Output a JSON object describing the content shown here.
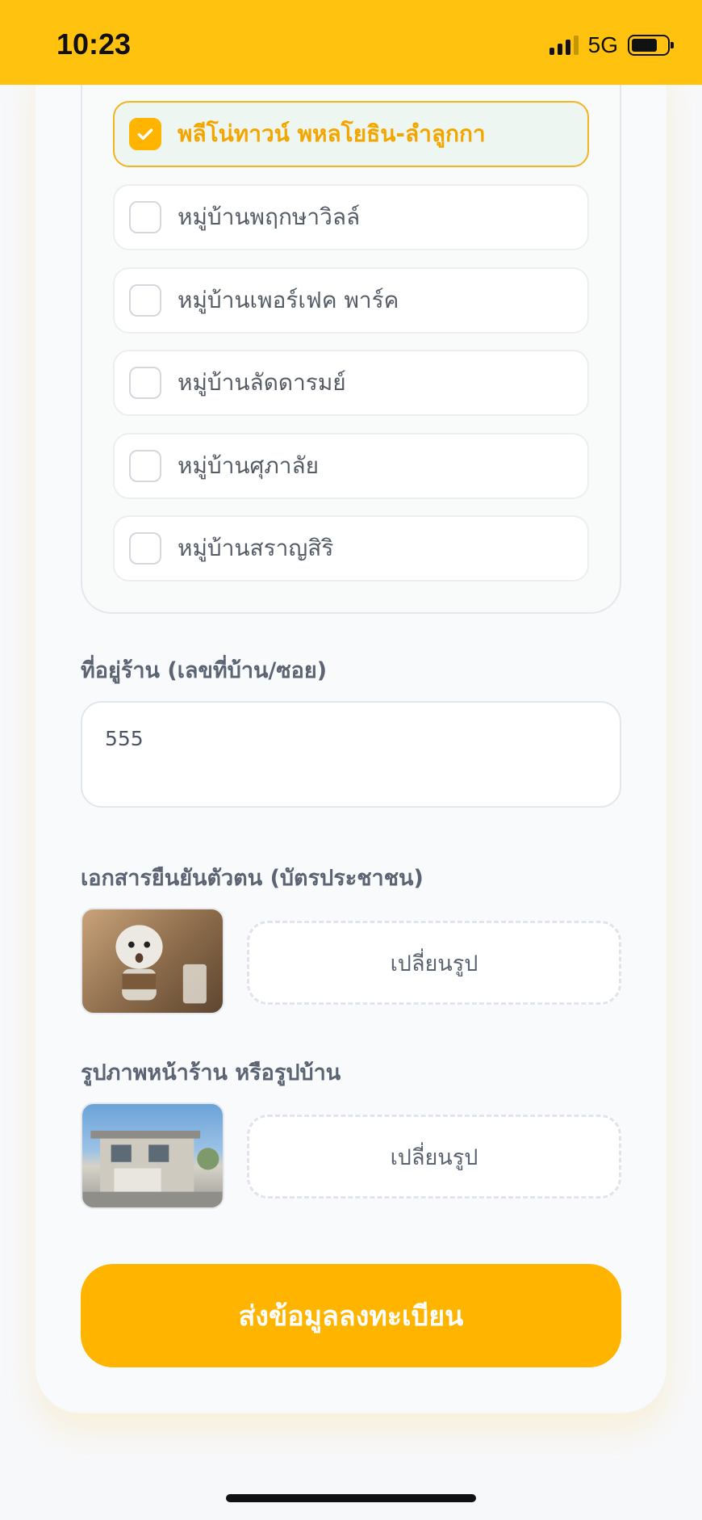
{
  "status_bar": {
    "time": "10:23",
    "network": "5G"
  },
  "village_options": [
    {
      "label": "พลีโน่ทาวน์ พหลโยธิน-ลำลูกกา",
      "checked": true
    },
    {
      "label": "หมู่บ้านพฤกษาวิลล์",
      "checked": false
    },
    {
      "label": "หมู่บ้านเพอร์เฟค พาร์ค",
      "checked": false
    },
    {
      "label": "หมู่บ้านลัดดารมย์",
      "checked": false
    },
    {
      "label": "หมู่บ้านศุภาลัย",
      "checked": false
    },
    {
      "label": "หมู่บ้านสราญสิริ",
      "checked": false
    }
  ],
  "address": {
    "label": "ที่อยู่ร้าน (เลขที่บ้าน/ซอย)",
    "value": "555"
  },
  "id_document": {
    "label": "เอกสารยืนยันตัวตน (บัตรประชาชน)",
    "change_label": "เปลี่ยนรูป"
  },
  "shop_photo": {
    "label": "รูปภาพหน้าร้าน หรือรูปบ้าน",
    "change_label": "เปลี่ยนรูป"
  },
  "submit": {
    "label": "ส่งข้อมูลลงทะเบียน"
  },
  "colors": {
    "accent": "#ffb400",
    "status_bar": "#ffc20e"
  }
}
